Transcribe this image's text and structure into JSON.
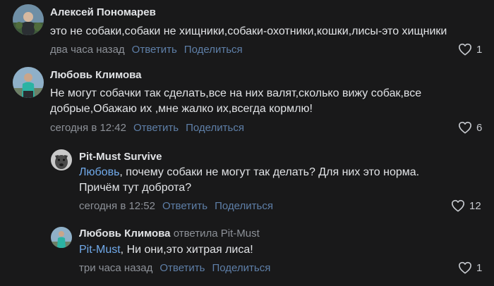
{
  "comments": [
    {
      "author": "Алексей Пономарев",
      "lines": [
        "это не собаки,собаки не хищники,собаки-охотники,кошки,лисы-это хищники"
      ],
      "time": "два часа назад",
      "reply_label": "Ответить",
      "share_label": "Поделиться",
      "likes": "1"
    },
    {
      "author": "Любовь Климова",
      "lines": [
        "Не могут собачки так сделать,все на них валят,сколько вижу собак,все",
        "добрые,Обажаю их ,мне жалко их,всегда кормлю!"
      ],
      "time": "сегодня в 12:42",
      "reply_label": "Ответить",
      "share_label": "Поделиться",
      "likes": "6"
    },
    {
      "author": "Pit-Must Survive",
      "mention": "Любовь",
      "lines": [
        ", почему собаки не могут так делать? Для них это норма.",
        "Причём тут доброта?"
      ],
      "time": "сегодня в 12:52",
      "reply_label": "Ответить",
      "share_label": "Поделиться",
      "likes": "12"
    },
    {
      "author": "Любовь Климова",
      "replied_to": "ответила Pit-Must",
      "mention": "Pit-Must",
      "lines": [
        ", Ни они,это хитрая лиса!"
      ],
      "time": "три часа назад",
      "reply_label": "Ответить",
      "share_label": "Поделиться",
      "likes": "1"
    }
  ],
  "colors": {
    "background": "#19191a",
    "text": "#e1e3e6",
    "muted": "#8d9198",
    "link": "#5e7fa8",
    "mention": "#71aaeb"
  },
  "icons": {
    "like": "heart-icon"
  }
}
